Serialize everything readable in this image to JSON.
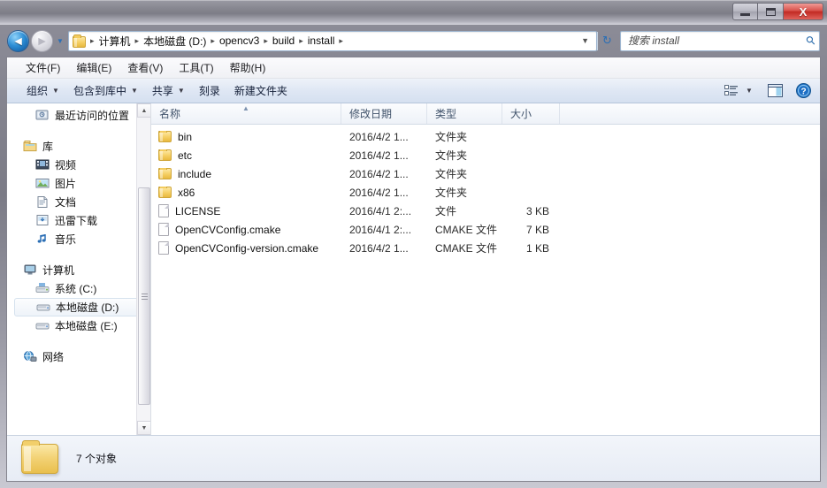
{
  "window": {
    "controls": {
      "minimize": "minimize-button",
      "restore": "restore-button",
      "close": "X"
    }
  },
  "nav": {
    "back_label": "◄",
    "forward_label": "►",
    "history_caret": "▼",
    "refresh_label": "↻",
    "address_dropdown": "▼"
  },
  "breadcrumb": {
    "separator": "▸",
    "items": [
      "计算机",
      "本地磁盘 (D:)",
      "opencv3",
      "build",
      "install"
    ],
    "trailing_separator": "▸"
  },
  "search": {
    "placeholder": "搜索 install",
    "value": "",
    "icon": "search-icon"
  },
  "menubar": {
    "items": [
      "文件(F)",
      "编辑(E)",
      "查看(V)",
      "工具(T)",
      "帮助(H)"
    ]
  },
  "toolbar": {
    "items": [
      {
        "label": "组织",
        "caret": "▼"
      },
      {
        "label": "包含到库中",
        "caret": "▼"
      },
      {
        "label": "共享",
        "caret": "▼"
      },
      {
        "label": "刻录",
        "caret": ""
      },
      {
        "label": "新建文件夹",
        "caret": ""
      }
    ],
    "view_caret": "▼",
    "view_icon": "view-options-icon",
    "preview_icon": "preview-pane-icon",
    "help_icon": "help-icon",
    "help_glyph": "?"
  },
  "sidebar": {
    "groups": [
      {
        "type": "item",
        "label": "最近访问的位置",
        "icon": "recent-places-icon",
        "level": "child",
        "selected": false
      },
      {
        "type": "gap"
      },
      {
        "type": "item",
        "label": "库",
        "icon": "library-icon",
        "level": "header",
        "selected": false
      },
      {
        "type": "item",
        "label": "视频",
        "icon": "video-icon",
        "level": "child",
        "selected": false
      },
      {
        "type": "item",
        "label": "图片",
        "icon": "pictures-icon",
        "level": "child",
        "selected": false
      },
      {
        "type": "item",
        "label": "文档",
        "icon": "documents-icon",
        "level": "child",
        "selected": false
      },
      {
        "type": "item",
        "label": "迅雷下载",
        "icon": "downloads-icon",
        "level": "child",
        "selected": false
      },
      {
        "type": "item",
        "label": "音乐",
        "icon": "music-icon",
        "level": "child",
        "selected": false
      },
      {
        "type": "gap"
      },
      {
        "type": "item",
        "label": "计算机",
        "icon": "computer-icon",
        "level": "header",
        "selected": false
      },
      {
        "type": "item",
        "label": "系统 (C:)",
        "icon": "system-drive-icon",
        "level": "child",
        "selected": false
      },
      {
        "type": "item",
        "label": "本地磁盘 (D:)",
        "icon": "drive-icon",
        "level": "child",
        "selected": true
      },
      {
        "type": "item",
        "label": "本地磁盘 (E:)",
        "icon": "drive-icon",
        "level": "child",
        "selected": false
      },
      {
        "type": "gap"
      },
      {
        "type": "item",
        "label": "网络",
        "icon": "network-icon",
        "level": "header",
        "selected": false
      }
    ],
    "scrollbar": {
      "up": "▲",
      "down": "▼"
    }
  },
  "filelist": {
    "columns": [
      {
        "key": "name",
        "label": "名称",
        "sorted": "asc",
        "sort_glyph": "▲"
      },
      {
        "key": "date",
        "label": "修改日期"
      },
      {
        "key": "type",
        "label": "类型"
      },
      {
        "key": "size",
        "label": "大小"
      }
    ],
    "rows": [
      {
        "name": "bin",
        "date": "2016/4/2 1...",
        "type": "文件夹",
        "size": "",
        "icon": "folder-icon"
      },
      {
        "name": "etc",
        "date": "2016/4/2 1...",
        "type": "文件夹",
        "size": "",
        "icon": "folder-icon"
      },
      {
        "name": "include",
        "date": "2016/4/2 1...",
        "type": "文件夹",
        "size": "",
        "icon": "folder-icon"
      },
      {
        "name": "x86",
        "date": "2016/4/2 1...",
        "type": "文件夹",
        "size": "",
        "icon": "folder-icon"
      },
      {
        "name": "LICENSE",
        "date": "2016/4/1 2:...",
        "type": "文件",
        "size": "3 KB",
        "icon": "file-icon"
      },
      {
        "name": "OpenCVConfig.cmake",
        "date": "2016/4/1 2:...",
        "type": "CMAKE 文件",
        "size": "7 KB",
        "icon": "file-icon"
      },
      {
        "name": "OpenCVConfig-version.cmake",
        "date": "2016/4/2 1...",
        "type": "CMAKE 文件",
        "size": "1 KB",
        "icon": "file-icon"
      }
    ]
  },
  "statusbar": {
    "text": "7 个对象",
    "icon": "folder-large-icon"
  },
  "colors": {
    "accent_blue": "#2b6fb5",
    "close_red": "#c22a23",
    "folder_yellow": "#f3cc60",
    "selection_blue": "#e9f3fd",
    "toolbar_blue": "#dfe7f4"
  }
}
